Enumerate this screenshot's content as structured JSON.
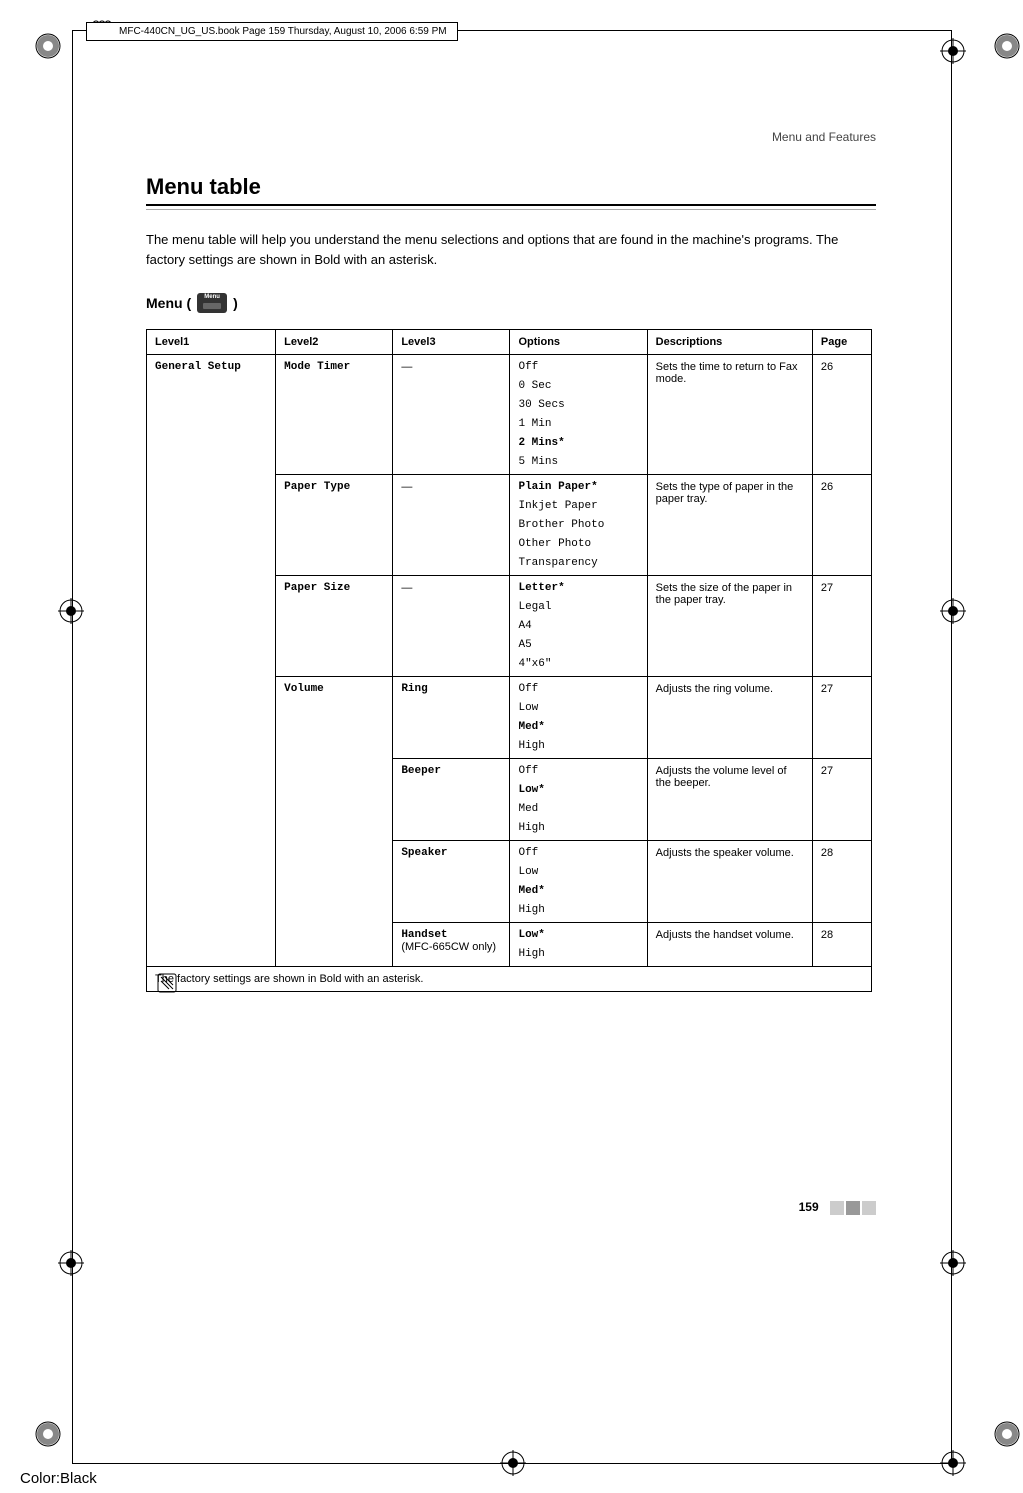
{
  "meta": {
    "book_stamp": "MFC-440CN_UG_US.book  Page 159  Thursday, August 10, 2006  6:59 PM",
    "running_head": "Menu and Features",
    "page_number": "159",
    "color_label": "Color:Black"
  },
  "section": {
    "title": "Menu table",
    "intro": "The menu table will help you understand the menu selections and options that are found in the machine's programs. The factory settings are shown in Bold with an asterisk.",
    "menu_heading_prefix": "Menu (",
    "menu_heading_suffix": ")",
    "menu_icon_label": "Menu"
  },
  "table": {
    "headers": {
      "l1": "Level1",
      "l2": "Level2",
      "l3": "Level3",
      "opt": "Options",
      "desc": "Descriptions",
      "page": "Page"
    },
    "level1": {
      "label": "General Setup"
    },
    "rows": [
      {
        "l2": "Mode Timer",
        "l3": "—",
        "options": [
          {
            "t": "Off",
            "b": false
          },
          {
            "t": "0 Sec",
            "b": false
          },
          {
            "t": "30 Secs",
            "b": false
          },
          {
            "t": "1 Min",
            "b": false
          },
          {
            "t": "2 Mins*",
            "b": true
          },
          {
            "t": "5 Mins",
            "b": false
          }
        ],
        "desc": "Sets the time to return to Fax mode.",
        "page": "26"
      },
      {
        "l2": "Paper Type",
        "l3": "—",
        "options": [
          {
            "t": "Plain Paper*",
            "b": true
          },
          {
            "t": "Inkjet Paper",
            "b": false
          },
          {
            "t": "Brother Photo",
            "b": false
          },
          {
            "t": "Other Photo",
            "b": false
          },
          {
            "t": "Transparency",
            "b": false
          }
        ],
        "desc": "Sets the type of paper in the paper tray.",
        "page": "26"
      },
      {
        "l2": "Paper Size",
        "l3": "—",
        "options": [
          {
            "t": "Letter*",
            "b": true
          },
          {
            "t": "Legal",
            "b": false
          },
          {
            "t": "A4",
            "b": false
          },
          {
            "t": "A5",
            "b": false
          },
          {
            "t": "4\"x6\"",
            "b": false
          }
        ],
        "desc": "Sets the size of the paper in the paper tray.",
        "page": "27"
      },
      {
        "l2": "Volume",
        "l3": "Ring",
        "l3_b": true,
        "options": [
          {
            "t": "Off",
            "b": false
          },
          {
            "t": "Low",
            "b": false
          },
          {
            "t": "Med*",
            "b": true
          },
          {
            "t": "High",
            "b": false
          }
        ],
        "desc": "Adjusts the ring volume.",
        "page": "27"
      },
      {
        "l3": "Beeper",
        "l3_b": true,
        "options": [
          {
            "t": "Off",
            "b": false
          },
          {
            "t": "Low*",
            "b": true
          },
          {
            "t": "Med",
            "b": false
          },
          {
            "t": "High",
            "b": false
          }
        ],
        "desc": "Adjusts the volume level of the beeper.",
        "page": "27"
      },
      {
        "l3": "Speaker",
        "l3_b": true,
        "options": [
          {
            "t": "Off",
            "b": false
          },
          {
            "t": "Low",
            "b": false
          },
          {
            "t": "Med*",
            "b": true
          },
          {
            "t": "High",
            "b": false
          }
        ],
        "desc": "Adjusts the speaker volume.",
        "page": "28"
      },
      {
        "l3_parts": [
          {
            "t": "Handset",
            "b": true
          },
          {
            "t": "(MFC-665CW only)",
            "b": false
          }
        ],
        "options": [
          {
            "t": "Low*",
            "b": true
          },
          {
            "t": "High",
            "b": false
          }
        ],
        "desc": "Adjusts the handset volume.",
        "page": "28"
      }
    ],
    "footnote": "The factory settings are shown in Bold with an asterisk."
  }
}
